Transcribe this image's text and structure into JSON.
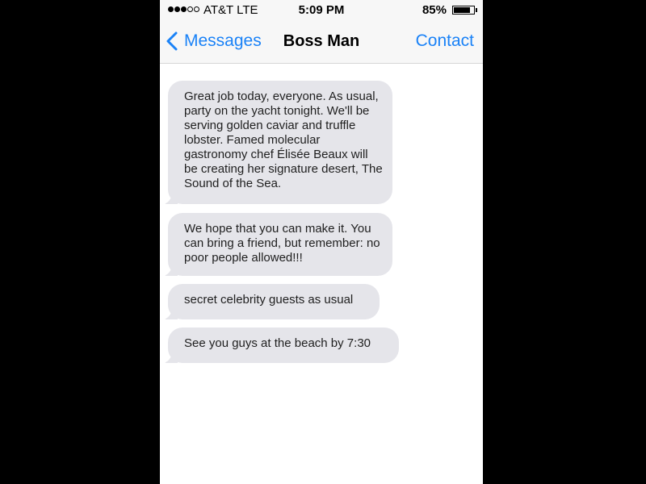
{
  "status_bar": {
    "signal_bars_filled": 3,
    "signal_bars_total": 5,
    "carrier": "AT&T LTE",
    "time": "5:09 PM",
    "battery_percent_text": "85%",
    "battery_level": 0.85
  },
  "nav_bar": {
    "back_label": "Messages",
    "title": "Boss Man",
    "contact_label": "Contact",
    "back_icon": "chevron-left-icon"
  },
  "messages": [
    {
      "direction": "incoming",
      "text": "Great job today, everyone. As usual, party on the yacht tonight. We'll be serving golden caviar and truffle lobster. Famed molecular gastronomy chef Élisée Beaux will be creating her signature desert, The Sound of the Sea."
    },
    {
      "direction": "incoming",
      "text": "We hope that you can make it. You can bring a friend, but remember: no poor people allowed!!!"
    },
    {
      "direction": "incoming",
      "text": "secret celebrity guests as usual"
    },
    {
      "direction": "incoming",
      "text": "See you guys at the beach by 7:30"
    }
  ],
  "colors": {
    "accent": "#1a82f7",
    "incoming_bubble": "#e5e5ea",
    "bar_background": "#f7f7f7",
    "outer_background": "#000000"
  }
}
